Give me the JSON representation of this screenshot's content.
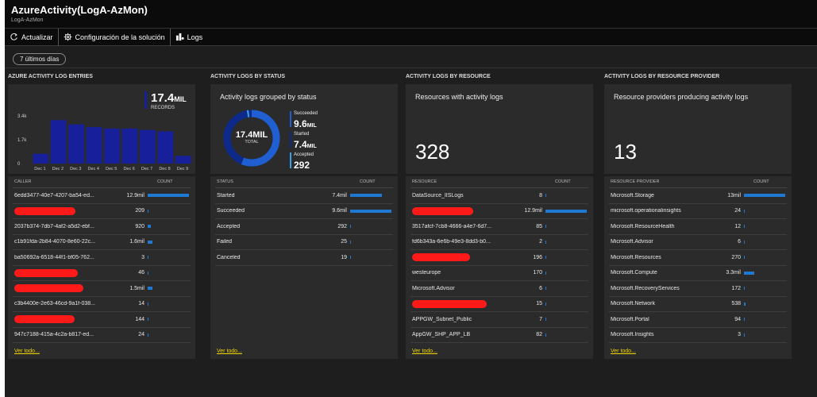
{
  "app": {
    "title": "AzureActivity(LogA-AzMon)",
    "subtitle": "LogA-AzMon"
  },
  "toolbar": {
    "refresh_label": "Actualizar",
    "config_label": "Configuración de la solución",
    "logs_label": "Logs"
  },
  "timerange": {
    "label": "7 últimos días"
  },
  "see_all": "Ver todo...",
  "colors": {
    "accent": "#1f78d1",
    "bar": "#17209a",
    "link": "#f2d600",
    "redaction": "#ff1a1a"
  },
  "entries": {
    "section_title": "AZURE ACTIVITY LOG ENTRIES",
    "total_value": "17.4",
    "total_unit": "MIL",
    "total_label": "RECORDS",
    "col_name": "CALLER",
    "col_count": "COUNT",
    "rows": [
      {
        "name": "6edd3477-40e7-4207-ba54-ed...",
        "count": "12.9mil",
        "frac": 1.0
      },
      {
        "name": "",
        "count": "209",
        "frac": 0.02,
        "redacted": true
      },
      {
        "name": "2037b374-7db7-4af2-a5d2-ebf...",
        "count": "920",
        "frac": 0.07
      },
      {
        "name": "c1b91fda-2b84-4070-8e60-22c...",
        "count": "1.6mil",
        "frac": 0.12
      },
      {
        "name": "ba50692a-6518-44f1-bf05-762...",
        "count": "3",
        "frac": 0.0
      },
      {
        "name": "",
        "count": "46",
        "frac": 0.0,
        "redacted": true
      },
      {
        "name": "",
        "count": "1.5mil",
        "frac": 0.11,
        "redacted": true
      },
      {
        "name": "c3b4400e-2e63-46cd-9a1f-038...",
        "count": "14",
        "frac": 0.0
      },
      {
        "name": "",
        "count": "144",
        "frac": 0.01,
        "redacted": true
      },
      {
        "name": "947c7188-415a-4c2a-b817-ed...",
        "count": "24",
        "frac": 0.0
      }
    ]
  },
  "chart_data": {
    "type": "bar",
    "categories": [
      "Dec 1",
      "Dec 2",
      "Dec 3",
      "Dec 4",
      "Dec 5",
      "Dec 6",
      "Dec 7",
      "Dec 8",
      "Dec 9"
    ],
    "values": [
      700,
      3100,
      2800,
      2600,
      2500,
      2500,
      2400,
      2300,
      550
    ],
    "y_ticks": [
      "3.4k",
      "1.7k",
      "0"
    ],
    "ylim": [
      0,
      3400
    ],
    "grid": false
  },
  "status": {
    "section_title": "ACTIVITY LOGS BY STATUS",
    "tile_title": "Activity logs grouped by status",
    "donut_value": "17.4MIL",
    "donut_label": "TOTAL",
    "legend": [
      {
        "label": "Succeeded",
        "value": "9.6",
        "unit": "MIL",
        "color": "#1f5fd1"
      },
      {
        "label": "Started",
        "value": "7.4",
        "unit": "MIL",
        "color": "#0d2a8a"
      },
      {
        "label": "Accepted",
        "value": "292",
        "unit": "",
        "color": "#3aa0e8"
      }
    ],
    "col_name": "STATUS",
    "col_count": "COUNT",
    "rows": [
      {
        "name": "Started",
        "count": "7.4mil",
        "frac": 0.77
      },
      {
        "name": "Succeeded",
        "count": "9.6mil",
        "frac": 1.0
      },
      {
        "name": "Accepted",
        "count": "292",
        "frac": 0.02
      },
      {
        "name": "Failed",
        "count": "25",
        "frac": 0.0
      },
      {
        "name": "Canceled",
        "count": "19",
        "frac": 0.0
      }
    ]
  },
  "resource": {
    "section_title": "ACTIVITY LOGS BY RESOURCE",
    "tile_title": "Resources with activity logs",
    "big_number": "328",
    "col_name": "RESOURCE",
    "col_count": "COUNT",
    "rows": [
      {
        "name": "DataSource_IISLogs",
        "count": "8",
        "frac": 0.0
      },
      {
        "name": "",
        "count": "12.9mil",
        "frac": 1.0,
        "redacted": true
      },
      {
        "name": "3517afcf-7cb8-4666-a4e7-6d7...",
        "count": "85",
        "frac": 0.0
      },
      {
        "name": "fd6b343a-6e6b-49e3-8dd3-b0...",
        "count": "2",
        "frac": 0.0
      },
      {
        "name": "",
        "count": "196",
        "frac": 0.0,
        "redacted": true
      },
      {
        "name": "westeurope",
        "count": "170",
        "frac": 0.0
      },
      {
        "name": "Microsoft.Advisor",
        "count": "6",
        "frac": 0.0
      },
      {
        "name": "",
        "count": "15",
        "frac": 0.0,
        "redacted": true
      },
      {
        "name": "APPGW_Subnet_Public",
        "count": "7",
        "frac": 0.0
      },
      {
        "name": "AppGW_SHP_APP_LB",
        "count": "82",
        "frac": 0.0
      }
    ]
  },
  "provider": {
    "section_title": "ACTIVITY LOGS BY RESOURCE PROVIDER",
    "tile_title": "Resource providers producing activity logs",
    "big_number": "13",
    "col_name": "RESOURCE PROVIDER",
    "col_count": "COUNT",
    "rows": [
      {
        "name": "Microsoft.Storage",
        "count": "13mil",
        "frac": 1.0
      },
      {
        "name": "microsoft.operationalinsights",
        "count": "24",
        "frac": 0.0
      },
      {
        "name": "Microsoft.ResourceHealth",
        "count": "12",
        "frac": 0.0
      },
      {
        "name": "Microsoft.Advisor",
        "count": "6",
        "frac": 0.0
      },
      {
        "name": "Microsoft.Resources",
        "count": "270",
        "frac": 0.02
      },
      {
        "name": "Microsoft.Compute",
        "count": "3.3mil",
        "frac": 0.25
      },
      {
        "name": "Microsoft.RecoveryServices",
        "count": "172",
        "frac": 0.0
      },
      {
        "name": "Microsoft.Network",
        "count": "538",
        "frac": 0.04
      },
      {
        "name": "Microsoft.Portal",
        "count": "94",
        "frac": 0.0
      },
      {
        "name": "Microsoft.Insights",
        "count": "3",
        "frac": 0.0
      }
    ]
  }
}
